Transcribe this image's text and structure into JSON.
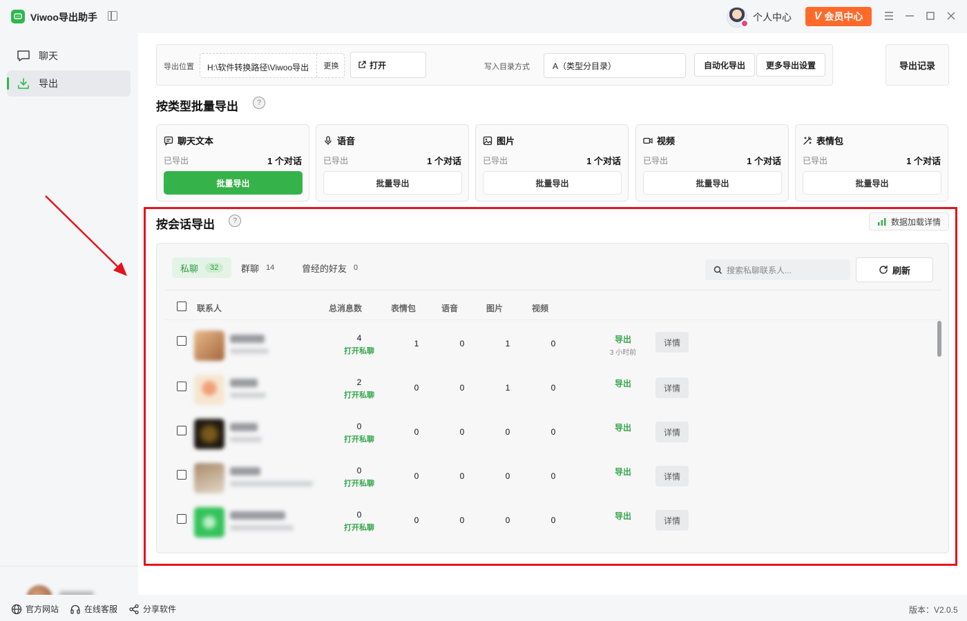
{
  "app": {
    "title": "Viwoo导出助手"
  },
  "header": {
    "profile_label": "个人中心",
    "vip_badge": "V",
    "vip_label": "会员中心"
  },
  "sidebar": {
    "items": [
      {
        "label": "聊天",
        "icon": "chat-bubble-icon"
      },
      {
        "label": "导出",
        "icon": "download-icon",
        "active": true
      }
    ]
  },
  "toolbar": {
    "export_location_label": "导出位置",
    "export_path": "H:\\软件转换路径\\Viwoo导出",
    "change_label": "更换",
    "open_label": "打开",
    "write_mode_label": "写入目录方式",
    "write_mode_value": "A（类型分目录）",
    "auto_export_label": "自动化导出",
    "more_settings_label": "更多导出设置",
    "export_records_label": "导出记录"
  },
  "batch_section": {
    "title": "按类型批量导出",
    "help": "?",
    "cards": [
      {
        "name": "聊天文本",
        "icon": "chat-text-icon",
        "exported_label": "已导出",
        "count": "1 个对话",
        "button": "批量导出",
        "primary": true
      },
      {
        "name": "语音",
        "icon": "microphone-icon",
        "exported_label": "已导出",
        "count": "1 个对话",
        "button": "批量导出"
      },
      {
        "name": "图片",
        "icon": "image-icon",
        "exported_label": "已导出",
        "count": "1 个对话",
        "button": "批量导出"
      },
      {
        "name": "视频",
        "icon": "video-icon",
        "exported_label": "已导出",
        "count": "1 个对话",
        "button": "批量导出"
      },
      {
        "name": "表情包",
        "icon": "magic-wand-icon",
        "exported_label": "已导出",
        "count": "1 个对话",
        "button": "批量导出"
      }
    ]
  },
  "session_section": {
    "title": "按会话导出",
    "help": "?",
    "load_details_label": "数据加载详情",
    "tabs": [
      {
        "label": "私聊",
        "count": "32",
        "active": true
      },
      {
        "label": "群聊",
        "count": "14"
      },
      {
        "label": "曾经的好友",
        "count": "0"
      }
    ],
    "search_placeholder": "搜索私聊联系人...",
    "refresh_label": "刷新",
    "columns": [
      "联系人",
      "总消息数",
      "表情包",
      "语音",
      "图片",
      "视频"
    ],
    "rows": [
      {
        "total": "4",
        "open_chat": "打开私聊",
        "stickers": "1",
        "voice": "0",
        "images": "1",
        "videos": "0",
        "export": "导出",
        "export_time": "3 小时前",
        "detail": "详情"
      },
      {
        "total": "2",
        "open_chat": "打开私聊",
        "stickers": "0",
        "voice": "0",
        "images": "1",
        "videos": "0",
        "export": "导出",
        "export_time": "",
        "detail": "详情"
      },
      {
        "total": "0",
        "open_chat": "打开私聊",
        "stickers": "0",
        "voice": "0",
        "images": "0",
        "videos": "0",
        "export": "导出",
        "export_time": "",
        "detail": "详情"
      },
      {
        "total": "0",
        "open_chat": "打开私聊",
        "stickers": "0",
        "voice": "0",
        "images": "0",
        "videos": "0",
        "export": "导出",
        "export_time": "",
        "detail": "详情"
      },
      {
        "total": "0",
        "open_chat": "打开私聊",
        "stickers": "0",
        "voice": "0",
        "images": "0",
        "videos": "0",
        "export": "导出",
        "export_time": "",
        "detail": "详情"
      }
    ]
  },
  "footer": {
    "links": [
      {
        "label": "官方网站",
        "icon": "globe-icon"
      },
      {
        "label": "在线客服",
        "icon": "headset-icon"
      },
      {
        "label": "分享软件",
        "icon": "share-icon"
      }
    ],
    "version": "版本：V2.0.5"
  },
  "colors": {
    "accent": "#35b24a",
    "vip": "#ff6a2b",
    "highlight_frame": "#e3141f"
  }
}
